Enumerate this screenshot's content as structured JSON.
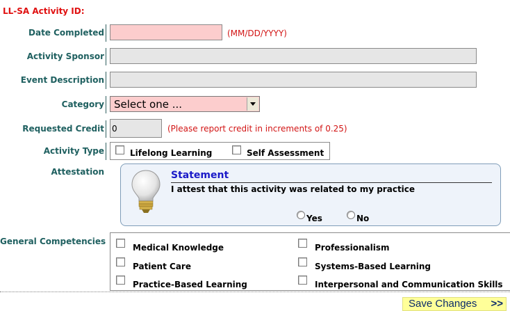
{
  "form": {
    "activity_id_label": "LL-SA Activity ID:",
    "date_completed": {
      "label": "Date Completed",
      "value": "",
      "hint": "(MM/DD/YYYY)"
    },
    "activity_sponsor": {
      "label": "Activity Sponsor",
      "value": ""
    },
    "event_description": {
      "label": "Event Description",
      "value": ""
    },
    "category": {
      "label": "Category",
      "selected": "Select one ..."
    },
    "requested_credit": {
      "label": "Requested Credit",
      "value": "0",
      "hint": "(Please report credit in increments of 0.25)"
    },
    "activity_type": {
      "label": "Activity Type",
      "options": [
        "Lifelong Learning",
        "Self Assessment"
      ]
    },
    "attestation": {
      "label": "Attestation",
      "title": "Statement",
      "text": "I attest that this activity was related to my practice",
      "yes": "Yes",
      "no": "No"
    },
    "general_competencies": {
      "label": "General Competencies",
      "left": [
        "Medical Knowledge",
        "Patient Care",
        "Practice-Based Learning"
      ],
      "right": [
        "Professionalism",
        "Systems-Based Learning",
        "Interpersonal and Communication Skills"
      ]
    },
    "save_label": "Save Changes",
    "save_arrow": ">>"
  },
  "colors": {
    "required_bg": "#fccdcd",
    "label_color": "#1f6060",
    "hint_color": "#d21414",
    "statement_title": "#1a1ac8",
    "save_bg": "#ffff99"
  }
}
